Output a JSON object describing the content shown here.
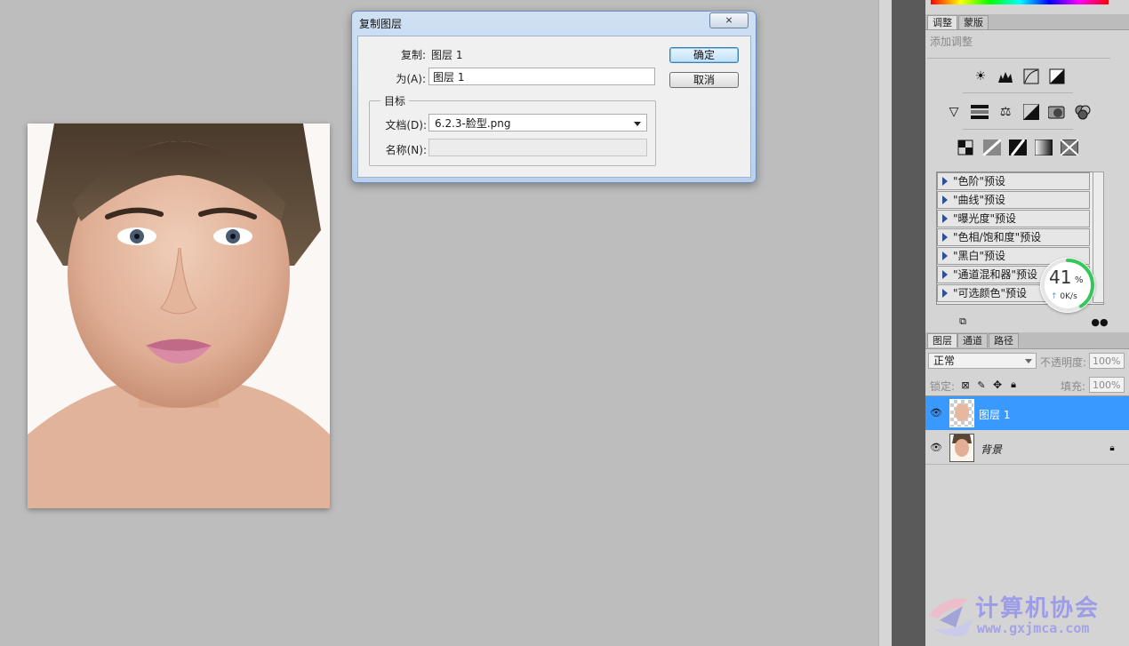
{
  "dialog": {
    "title": "复制图层",
    "close_label": "⨯",
    "copy_label": "复制:",
    "copy_value": "图层 1",
    "as_label": "为(A):",
    "as_value": "图层 1",
    "target_group": "目标",
    "document_label": "文档(D):",
    "document_value": "6.2.3-脸型.png",
    "name_label": "名称(N):",
    "name_value": "",
    "ok_label": "确定",
    "cancel_label": "取消"
  },
  "adjust_panel": {
    "tabs": [
      "调整",
      "蒙版"
    ],
    "subtitle": "添加调整",
    "presets": [
      "\"色阶\"预设",
      "\"曲线\"预设",
      "\"曝光度\"预设",
      "\"色相/饱和度\"预设",
      "\"黑白\"预设",
      "\"通道混和器\"预设",
      "\"可选颜色\"预设"
    ]
  },
  "speed_gauge": {
    "percent": "41",
    "percent_sign": "%",
    "speed": "0K/s",
    "fraction": 0.41
  },
  "layers_panel": {
    "tabs": [
      "图层",
      "通道",
      "路径"
    ],
    "blend_mode": "正常",
    "opacity_label": "不透明度:",
    "opacity_value": "100%",
    "lock_label": "锁定:",
    "fill_label": "填充:",
    "fill_value": "100%",
    "layers": [
      {
        "name": "图层 1",
        "selected": true
      },
      {
        "name": "背景",
        "selected": false
      }
    ]
  },
  "watermark": {
    "text": "计算机协会",
    "url": "www.gxjmca.com"
  },
  "colors": {
    "selected_layer": "#3a99ff",
    "dialog_border": "#6b8fb8",
    "gauge_green": "#35c759"
  }
}
